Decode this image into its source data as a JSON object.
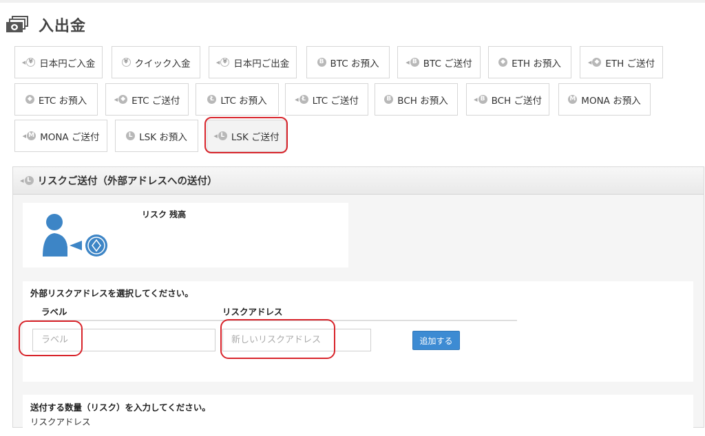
{
  "page": {
    "title": "入出金"
  },
  "tabs": [
    {
      "label": "日本円ご入金",
      "icon": "yen-in-icon"
    },
    {
      "label": "クイック入金",
      "icon": "quick-yen-icon"
    },
    {
      "label": "日本円ご出金",
      "icon": "yen-out-icon"
    },
    {
      "label": "BTC お預入",
      "icon": "btc-icon"
    },
    {
      "label": "BTC ご送付",
      "icon": "btc-send-icon"
    },
    {
      "label": "ETH お預入",
      "icon": "eth-icon"
    },
    {
      "label": "ETH ご送付",
      "icon": "eth-send-icon"
    },
    {
      "label": "ETC お預入",
      "icon": "etc-icon"
    },
    {
      "label": "ETC ご送付",
      "icon": "etc-send-icon"
    },
    {
      "label": "LTC お預入",
      "icon": "ltc-icon"
    },
    {
      "label": "LTC ご送付",
      "icon": "ltc-send-icon"
    },
    {
      "label": "BCH お預入",
      "icon": "bch-icon"
    },
    {
      "label": "BCH ご送付",
      "icon": "bch-send-icon"
    },
    {
      "label": "MONA お預入",
      "icon": "mona-icon"
    },
    {
      "label": "MONA ご送付",
      "icon": "mona-send-icon"
    },
    {
      "label": "LSK お預入",
      "icon": "lsk-icon"
    },
    {
      "label": "LSK ご送付",
      "icon": "lsk-send-icon",
      "active": true
    }
  ],
  "panel": {
    "title": "リスクご送付（外部アドレスへの送付）",
    "balance_label": "リスク 残高",
    "address_section": {
      "title": "外部リスクアドレスを選択してください。",
      "label_header": "ラベル",
      "address_header": "リスクアドレス",
      "label_placeholder": "ラベル",
      "address_placeholder": "新しいリスクアドレス",
      "add_button": "追加する"
    },
    "quantity_section": {
      "title": "送付する数量（リスク）を入力してください。",
      "sub": "リスクアドレス"
    }
  },
  "colors": {
    "accent": "#3d8bd3",
    "highlight": "#d8232a",
    "user_icon": "#3d85c6"
  }
}
